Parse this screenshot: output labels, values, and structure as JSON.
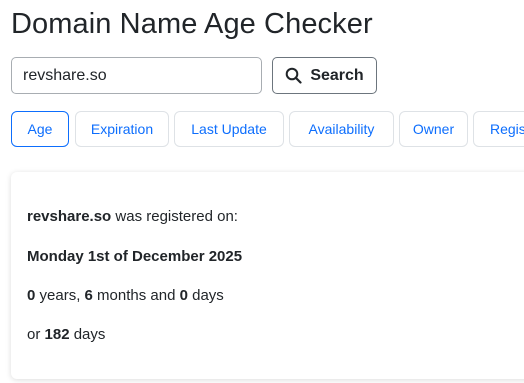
{
  "title": "Domain Name Age Checker",
  "search": {
    "value": "revshare.so",
    "button_label": "Search",
    "icon": "search-icon"
  },
  "tabs": [
    {
      "label": "Age",
      "active": true
    },
    {
      "label": "Expiration",
      "active": false
    },
    {
      "label": "Last Update",
      "active": false
    },
    {
      "label": "Availability",
      "active": false
    },
    {
      "label": "Owner",
      "active": false
    },
    {
      "label": "Regis",
      "active": false
    }
  ],
  "result": {
    "domain": "revshare.so",
    "registered_text": " was registered on:",
    "date": "Monday 1st of December 2025",
    "years": "0",
    "years_label": " years, ",
    "months": "6",
    "months_label": " months and ",
    "days": "0",
    "days_label": " days",
    "or_label": "or ",
    "total_days": "182",
    "total_days_label": " days"
  },
  "colors": {
    "accent": "#0d6efd",
    "text": "#212529",
    "tab_border": "#dee2e6"
  }
}
